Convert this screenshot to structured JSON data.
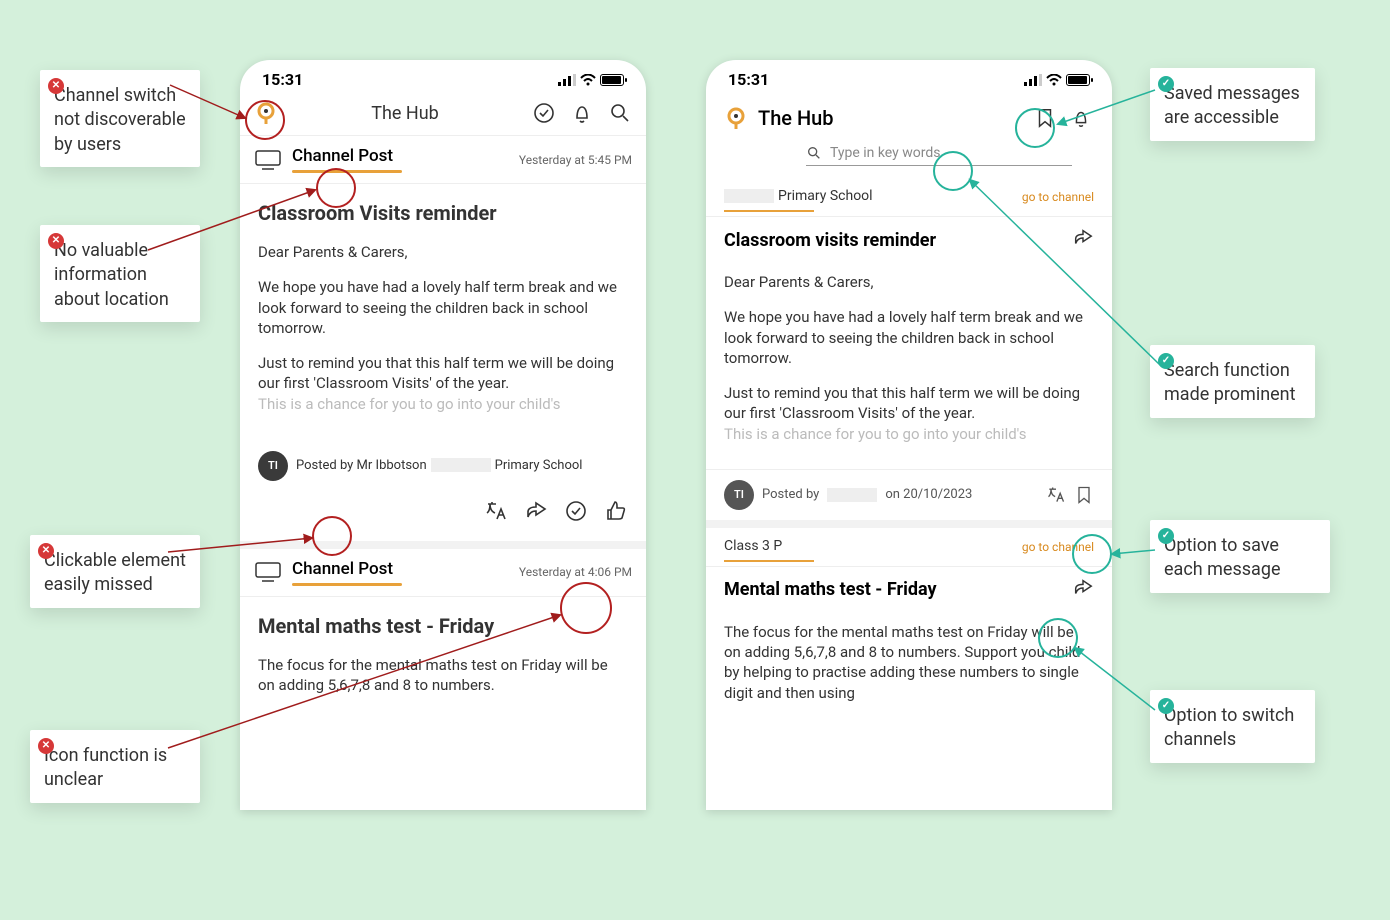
{
  "status": {
    "time": "15:31"
  },
  "left": {
    "app_title": "The Hub",
    "posts": [
      {
        "tag": "Channel Post",
        "timestamp": "Yesterday at 5:45 PM",
        "title": "Classroom Visits reminder",
        "greeting": "Dear Parents & Carers,",
        "para1": "We hope you have had a lovely half term break and we look forward to seeing the children back in school tomorrow.",
        "para2a": "Just to remind you that this half term we will be doing our first 'Classroom Visits' of the year.",
        "para2fade": "This is a chance for you to go into your child's",
        "avatar": "TI",
        "posted": "Posted by Mr Ibbotson",
        "posted_school": "Primary School"
      },
      {
        "tag": "Channel Post",
        "timestamp": "Yesterday at 4:06 PM",
        "title": "Mental maths test - Friday",
        "para1": "The focus for the mental maths test on Friday will be on adding 5,6,7,8 and 8 to numbers."
      }
    ]
  },
  "right": {
    "app_title": "The Hub",
    "search_placeholder": "Type in key words",
    "posts": [
      {
        "channel_suffix": "Primary School",
        "go_channel": "go to channel",
        "title": "Classroom visits reminder",
        "greeting": "Dear Parents & Carers,",
        "para1": "We hope you have had a lovely half term break and we look forward to seeing the children back in school tomorrow.",
        "para2a": "Just to remind you that this half term we will be doing our first 'Classroom Visits' of the year.",
        "para2fade": "This is a chance for you to go into your child's",
        "avatar": "TI",
        "posted_prefix": "Posted by",
        "posted_date": "on 20/10/2023"
      },
      {
        "channel": "Class 3 P",
        "go_channel": "go to channel",
        "title": "Mental maths test - Friday",
        "para1": "The focus for the mental maths test on Friday will be on adding 5,6,7,8 and 8 to numbers. Support you child by helping to practise adding these numbers to single digit and then using"
      }
    ]
  },
  "annotations": {
    "neg1": "Channel switch not discoverable by users",
    "neg2": "No valuable information about location",
    "neg3": "Clickable element easily missed",
    "neg4": "Icon function is unclear",
    "pos1": "Saved messages are accessible",
    "pos2": "Search function made prominent",
    "pos3": "Option to save each message",
    "pos4": "Option to switch channels"
  }
}
